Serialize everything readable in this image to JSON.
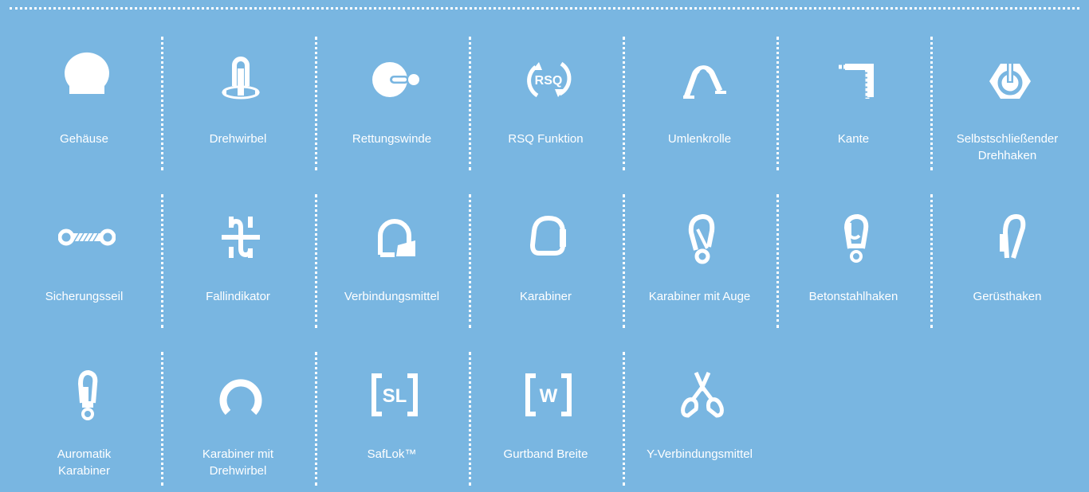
{
  "features": [
    {
      "label": "Gehäuse",
      "icon": "housing-icon"
    },
    {
      "label": "Drehwirbel",
      "icon": "swivel-icon"
    },
    {
      "label": "Rettungswinde",
      "icon": "rescue-winch-icon"
    },
    {
      "label": "RSQ Funktion",
      "icon": "rsq-function-icon"
    },
    {
      "label": "Umlenkrolle",
      "icon": "pulley-icon"
    },
    {
      "label": "Kante",
      "icon": "edge-icon"
    },
    {
      "label": "Selbstschließender\nDrehhaken",
      "icon": "self-closing-swivel-hook-icon"
    },
    {
      "label": "Sicherungsseil",
      "icon": "lifeline-cable-icon"
    },
    {
      "label": "Fallindikator",
      "icon": "fall-indicator-icon"
    },
    {
      "label": "Verbindungsmittel",
      "icon": "lanyard-connector-icon"
    },
    {
      "label": "Karabiner",
      "icon": "carabiner-icon"
    },
    {
      "label": "Karabiner mit Auge",
      "icon": "carabiner-with-eye-icon"
    },
    {
      "label": "Betonstahlhaken",
      "icon": "rebar-hook-icon"
    },
    {
      "label": "Gerüsthaken",
      "icon": "scaffold-hook-icon"
    },
    {
      "label": "Auromatik\nKarabiner",
      "icon": "automatic-carabiner-icon"
    },
    {
      "label": "Karabiner mit\nDrehwirbel",
      "icon": "swivel-carabiner-icon"
    },
    {
      "label": "SafLok™",
      "icon": "saflok-icon",
      "icon_text": "SL"
    },
    {
      "label": "Gurtband Breite",
      "icon": "webbing-width-icon",
      "icon_text": "W"
    },
    {
      "label": "Y-Verbindungsmittel",
      "icon": "y-lanyard-icon"
    }
  ],
  "rsq_icon_text": "RSQ",
  "colors": {
    "background": "#79b6e1",
    "foreground": "#ffffff"
  }
}
